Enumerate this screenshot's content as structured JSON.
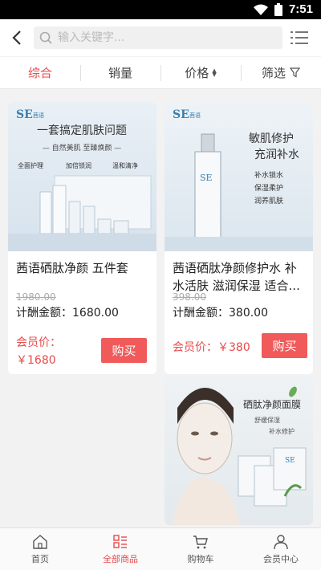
{
  "status_bar": {
    "time": "7:51"
  },
  "header": {
    "search_placeholder": "输入关键字..."
  },
  "tabs": [
    {
      "label": "综合",
      "active": true
    },
    {
      "label": "销量",
      "active": false
    },
    {
      "label": "价格",
      "active": false
    },
    {
      "label": "筛选",
      "active": false
    }
  ],
  "products": [
    {
      "name": "茜语硒肽净颜 五件套",
      "old_price": "1980.00",
      "commission_label": "计酬金额：",
      "commission": "1680.00",
      "member_label": "会员价：",
      "member_price": "￥1680",
      "buy_label": "购买",
      "image": {
        "brand": "SE",
        "brand_sub": "茜语",
        "headline": "一套搞定肌肤问题",
        "subline": "— 自然美肌 至臻焕颜 —",
        "features": [
          "全面护理",
          "加倍锁润",
          "温和清净"
        ]
      }
    },
    {
      "name": "茜语硒肽净颜修护水 补水活肤 滋润保湿 适合...",
      "old_price": "398.00",
      "commission_label": "计酬金额：",
      "commission": "380.00",
      "member_label": "会员价：",
      "member_price": "￥380",
      "buy_label": "购买",
      "image": {
        "brand": "SE",
        "brand_sub": "茜语",
        "headline": "敏肌修护",
        "headline2": "充润补水",
        "features": [
          "补水锁水",
          "保湿柔护",
          "润养肌肤"
        ]
      }
    },
    {
      "image": {
        "headline": "硒肽净颜面膜",
        "sub1": "舒缓保湿",
        "sub2": "补水修护",
        "brand": "SE"
      }
    }
  ],
  "bottom_nav": [
    {
      "label": "首页",
      "icon": "home-icon",
      "active": false
    },
    {
      "label": "全部商品",
      "icon": "grid-list-icon",
      "active": true
    },
    {
      "label": "购物车",
      "icon": "cart-icon",
      "active": false
    },
    {
      "label": "会员中心",
      "icon": "user-icon",
      "active": false
    }
  ],
  "colors": {
    "accent": "#e84a4a",
    "buy_button": "#f05a5a"
  }
}
